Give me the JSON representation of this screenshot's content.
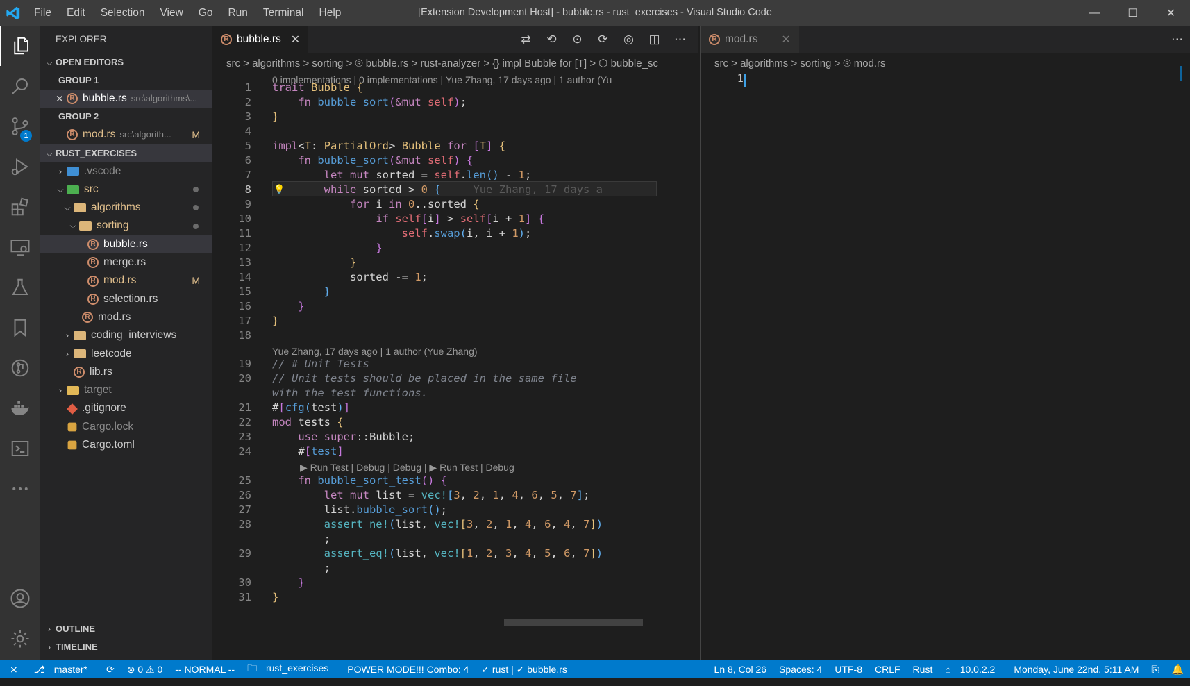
{
  "window": {
    "title": "[Extension Development Host] - bubble.rs - rust_exercises - Visual Studio Code",
    "menu": [
      "File",
      "Edit",
      "Selection",
      "View",
      "Go",
      "Run",
      "Terminal",
      "Help"
    ]
  },
  "activity": {
    "scm_badge": "1"
  },
  "sidebar": {
    "header": "EXPLORER",
    "open_editors": "OPEN EDITORS",
    "group1": "GROUP 1",
    "group1_file": "bubble.rs",
    "group1_path": "src\\algorithms\\...",
    "group2": "GROUP 2",
    "group2_file": "mod.rs",
    "group2_path": "src\\algorith...",
    "group2_status": "M",
    "project": "RUST_EXERCISES",
    "tree": {
      "vscode": ".vscode",
      "src": "src",
      "algorithms": "algorithms",
      "sorting": "sorting",
      "bubble": "bubble.rs",
      "merge": "merge.rs",
      "mod_sorting": "mod.rs",
      "mod_sorting_status": "M",
      "selection": "selection.rs",
      "mod_alg": "mod.rs",
      "coding": "coding_interviews",
      "leetcode": "leetcode",
      "lib": "lib.rs",
      "target": "target",
      "gitignore": ".gitignore",
      "cargolock": "Cargo.lock",
      "cargotoml": "Cargo.toml"
    },
    "outline": "OUTLINE",
    "timeline": "TIMELINE"
  },
  "editor1": {
    "tab": "bubble.rs",
    "breadcrumb": "src > algorithms > sorting > ® bubble.rs > rust-analyzer > {} impl Bubble for [T] > ⬡ bubble_sc",
    "lens_top": "0 implementations | 0 implementations | Yue Zhang, 17 days ago | 1 author (Yu",
    "lens_mid": "Yue Zhang, 17 days ago | 1 author (Yue Zhang)",
    "lens_test": "▶ Run Test | Debug | Debug | ▶ Run Test | Debug",
    "blame": "Yue Zhang, 17 days a",
    "line_numbers": [
      "1",
      "2",
      "3",
      "4",
      "5",
      "6",
      "7",
      "8",
      "9",
      "10",
      "11",
      "12",
      "13",
      "14",
      "15",
      "16",
      "17",
      "18",
      "19",
      "20",
      "",
      "21",
      "22",
      "23",
      "24",
      "25",
      "26",
      "27",
      "28",
      "",
      "29",
      "",
      "30",
      "31"
    ]
  },
  "editor2": {
    "tab": "mod.rs",
    "breadcrumb": "src > algorithms > sorting > ® mod.rs",
    "line": "1"
  },
  "status": {
    "branch": "master*",
    "errors": "⊗ 0 ⚠ 0",
    "mode": "-- NORMAL --",
    "folder": "rust_exercises",
    "power": "POWER MODE!!! Combo: 4",
    "rust": "✓ rust | ✓ bubble.rs",
    "position": "Ln 8, Col 26",
    "spaces": "Spaces: 4",
    "encoding": "UTF-8",
    "eol": "CRLF",
    "language": "Rust",
    "version": "10.0.2.2",
    "datetime": "Monday, June 22nd, 5:11 AM"
  }
}
